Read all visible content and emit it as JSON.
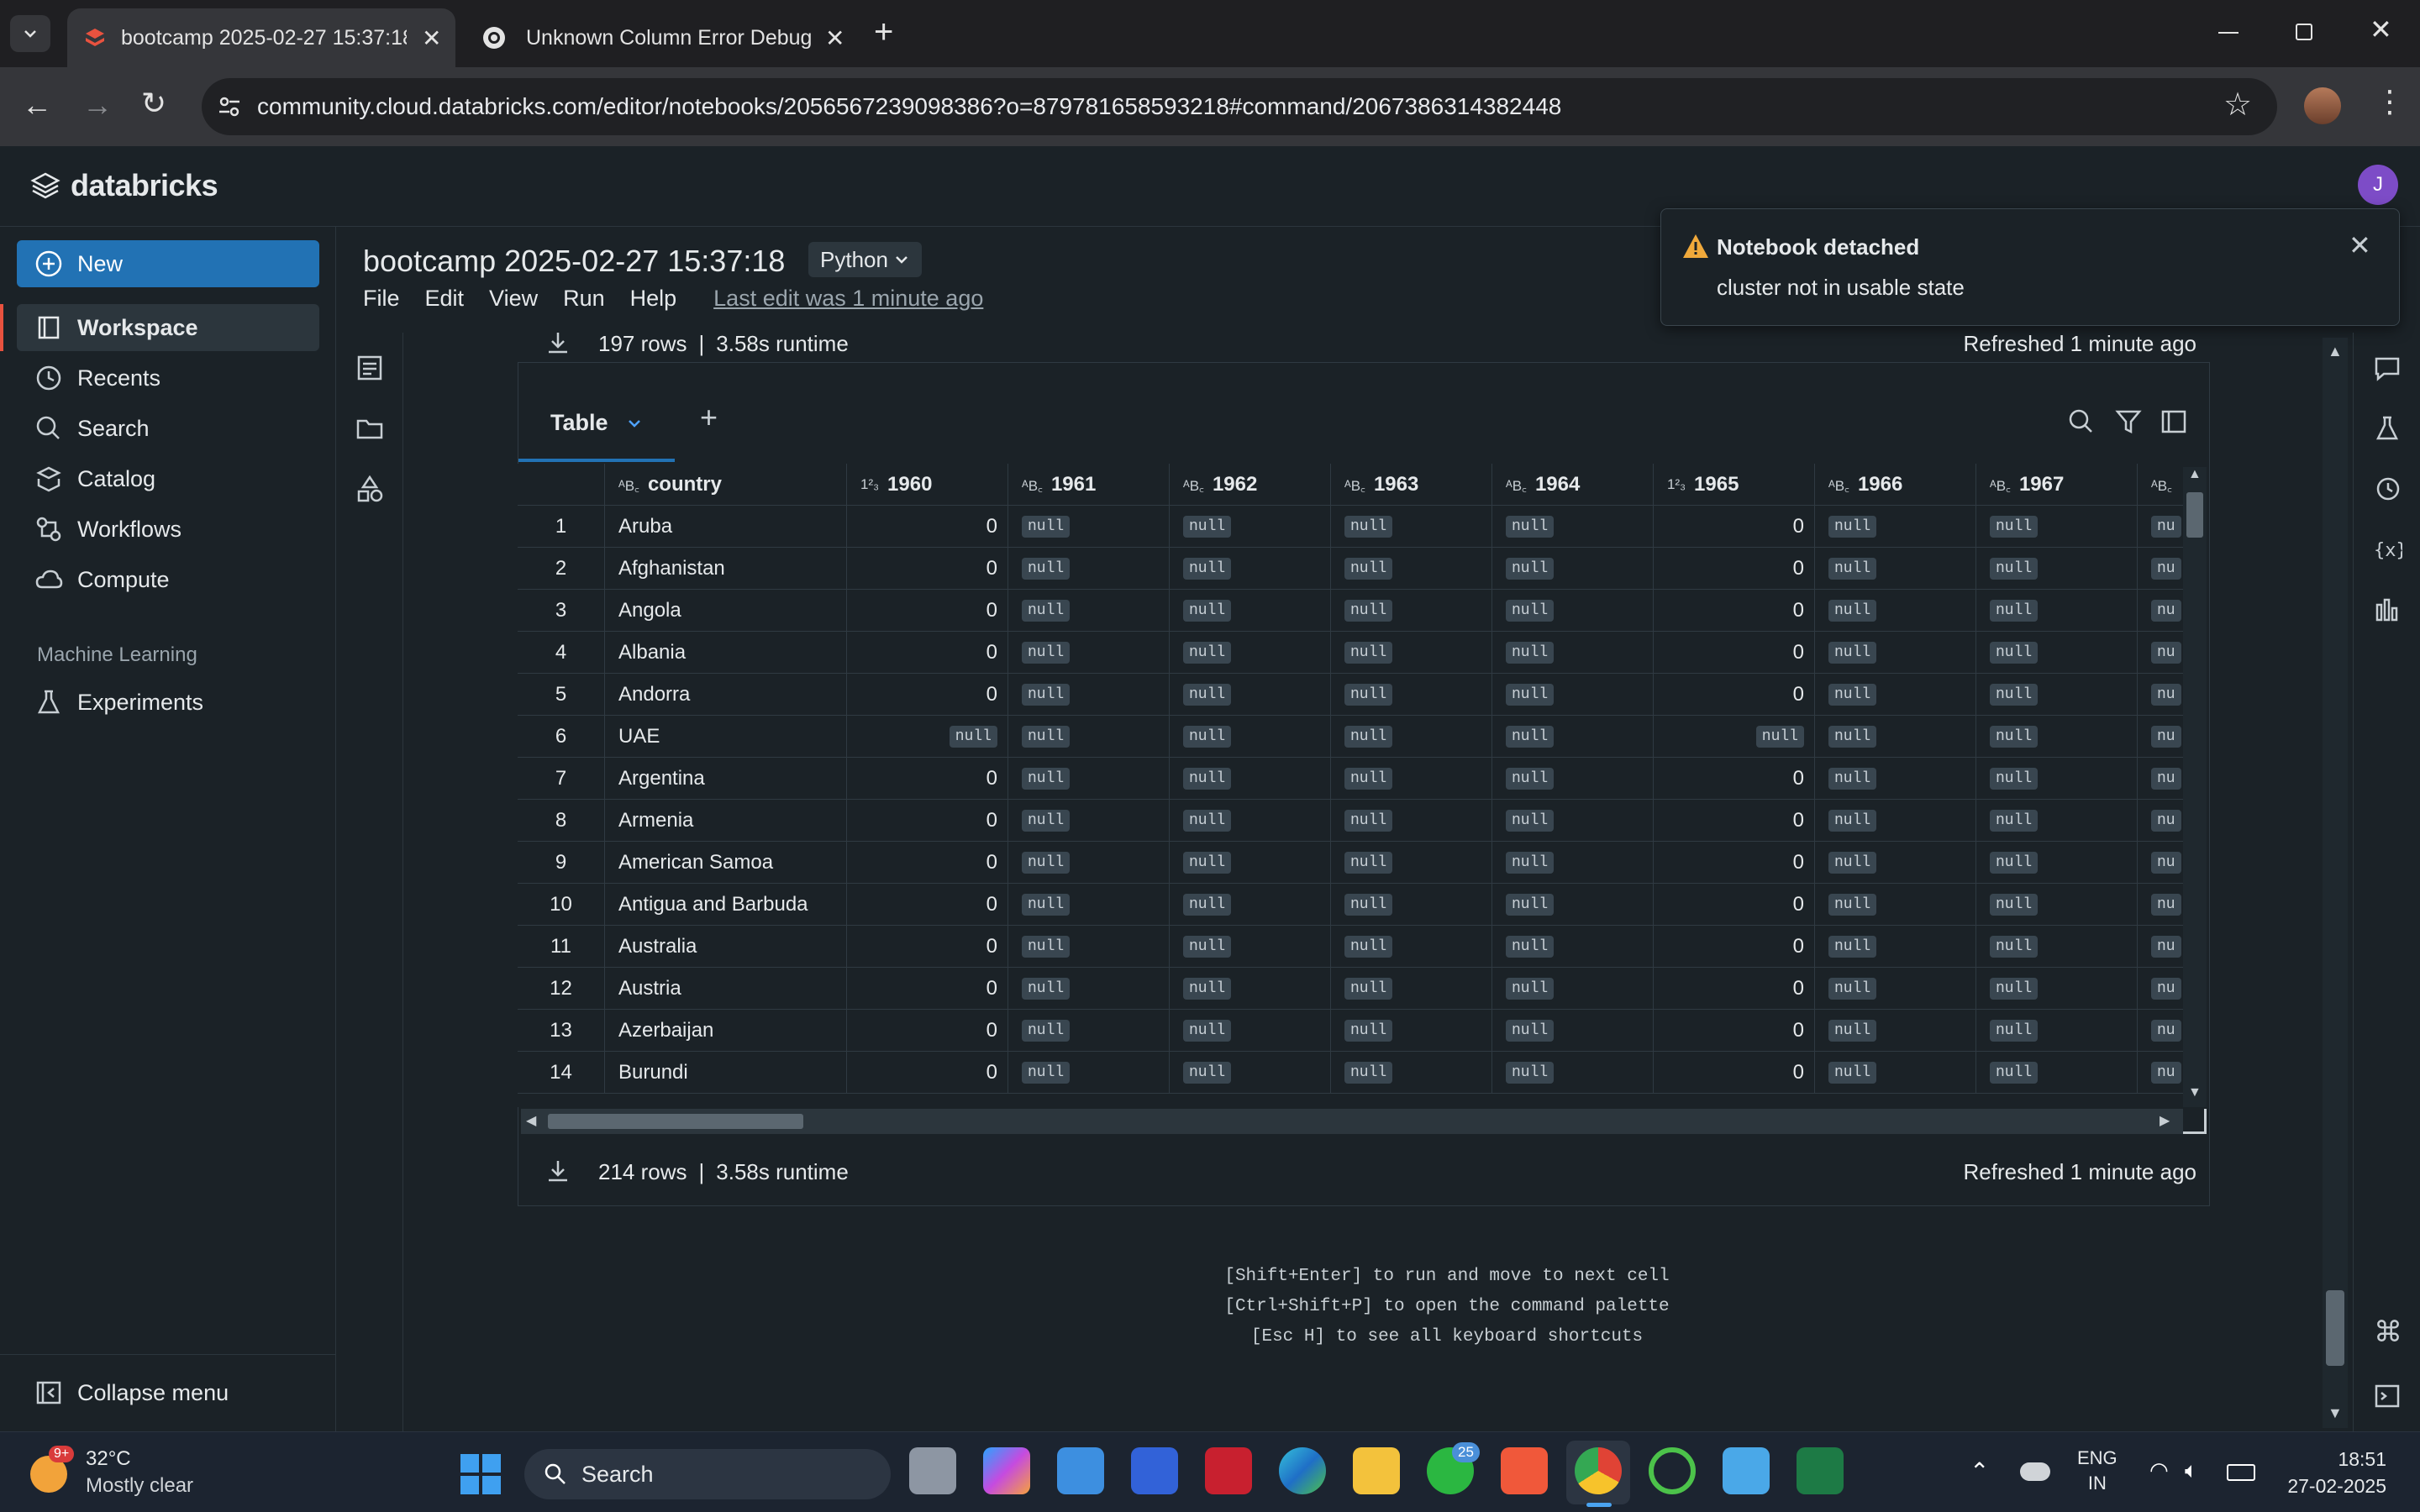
{
  "browser": {
    "tabs": [
      {
        "title": "bootcamp 2025-02-27 15:37:18",
        "active": true
      },
      {
        "title": "Unknown Column Error Debug",
        "active": false
      }
    ],
    "url": "community.cloud.databricks.com/editor/notebooks/2056567239098386?o=879781658593218#command/2067386314382448"
  },
  "app": {
    "logo_text": "databricks",
    "avatar_letter": "J"
  },
  "sidebar": {
    "new_label": "New",
    "items": [
      {
        "label": "Workspace",
        "icon": "workspace-icon",
        "active": true
      },
      {
        "label": "Recents",
        "icon": "clock-icon"
      },
      {
        "label": "Search",
        "icon": "search-icon"
      },
      {
        "label": "Catalog",
        "icon": "catalog-icon"
      },
      {
        "label": "Workflows",
        "icon": "workflows-icon"
      },
      {
        "label": "Compute",
        "icon": "cloud-icon"
      }
    ],
    "section_label": "Machine Learning",
    "ml_items": [
      {
        "label": "Experiments",
        "icon": "flask-icon"
      }
    ],
    "collapse_label": "Collapse menu"
  },
  "notebook": {
    "title": "bootcamp 2025-02-27 15:37:18",
    "language": "Python",
    "menu": [
      "File",
      "Edit",
      "View",
      "Run",
      "Help"
    ],
    "last_edit": "Last edit was 1 minute ago"
  },
  "toast": {
    "title": "Notebook detached",
    "message": "cluster not in usable state"
  },
  "prev_result": {
    "rows": "197 rows",
    "sep": "|",
    "runtime": "3.58s runtime",
    "refreshed": "Refreshed 1 minute ago"
  },
  "result": {
    "tab_label": "Table",
    "rows": "214 rows",
    "sep": "|",
    "runtime": "3.58s runtime",
    "refreshed": "Refreshed 1 minute ago",
    "columns": [
      {
        "name": "country",
        "type": "ABC"
      },
      {
        "name": "1960",
        "type": "123"
      },
      {
        "name": "1961",
        "type": "ABC"
      },
      {
        "name": "1962",
        "type": "ABC"
      },
      {
        "name": "1963",
        "type": "ABC"
      },
      {
        "name": "1964",
        "type": "ABC"
      },
      {
        "name": "1965",
        "type": "123"
      },
      {
        "name": "1966",
        "type": "ABC"
      },
      {
        "name": "1967",
        "type": "ABC"
      },
      {
        "name": "",
        "type": "ABC"
      }
    ],
    "rows_data": [
      {
        "n": "1",
        "cells": [
          "Aruba",
          "0",
          "null",
          "null",
          "null",
          "null",
          "0",
          "null",
          "null",
          "nu"
        ]
      },
      {
        "n": "2",
        "cells": [
          "Afghanistan",
          "0",
          "null",
          "null",
          "null",
          "null",
          "0",
          "null",
          "null",
          "nu"
        ]
      },
      {
        "n": "3",
        "cells": [
          "Angola",
          "0",
          "null",
          "null",
          "null",
          "null",
          "0",
          "null",
          "null",
          "nu"
        ]
      },
      {
        "n": "4",
        "cells": [
          "Albania",
          "0",
          "null",
          "null",
          "null",
          "null",
          "0",
          "null",
          "null",
          "nu"
        ]
      },
      {
        "n": "5",
        "cells": [
          "Andorra",
          "0",
          "null",
          "null",
          "null",
          "null",
          "0",
          "null",
          "null",
          "nu"
        ]
      },
      {
        "n": "6",
        "cells": [
          "UAE",
          "null",
          "null",
          "null",
          "null",
          "null",
          "null",
          "null",
          "null",
          "nu"
        ]
      },
      {
        "n": "7",
        "cells": [
          "Argentina",
          "0",
          "null",
          "null",
          "null",
          "null",
          "0",
          "null",
          "null",
          "nu"
        ]
      },
      {
        "n": "8",
        "cells": [
          "Armenia",
          "0",
          "null",
          "null",
          "null",
          "null",
          "0",
          "null",
          "null",
          "nu"
        ]
      },
      {
        "n": "9",
        "cells": [
          "American Samoa",
          "0",
          "null",
          "null",
          "null",
          "null",
          "0",
          "null",
          "null",
          "nu"
        ]
      },
      {
        "n": "10",
        "cells": [
          "Antigua and Barbuda",
          "0",
          "null",
          "null",
          "null",
          "null",
          "0",
          "null",
          "null",
          "nu"
        ]
      },
      {
        "n": "11",
        "cells": [
          "Australia",
          "0",
          "null",
          "null",
          "null",
          "null",
          "0",
          "null",
          "null",
          "nu"
        ]
      },
      {
        "n": "12",
        "cells": [
          "Austria",
          "0",
          "null",
          "null",
          "null",
          "null",
          "0",
          "null",
          "null",
          "nu"
        ]
      },
      {
        "n": "13",
        "cells": [
          "Azerbaijan",
          "0",
          "null",
          "null",
          "null",
          "null",
          "0",
          "null",
          "null",
          "nu"
        ]
      },
      {
        "n": "14",
        "cells": [
          "Burundi",
          "0",
          "null",
          "null",
          "null",
          "null",
          "0",
          "null",
          "null",
          "nu"
        ]
      }
    ]
  },
  "hints": [
    "[Shift+Enter] to run and move to next cell",
    "[Ctrl+Shift+P] to open the command palette",
    "[Esc H] to see all keyboard shortcuts"
  ],
  "taskbar": {
    "weather_temp": "32°C",
    "weather_desc": "Mostly clear",
    "weather_badge": "9+",
    "search_label": "Search",
    "whatsapp_badge": "25",
    "lang_top": "ENG",
    "lang_bottom": "IN",
    "time": "18:51",
    "date": "27-02-2025"
  },
  "colors": {
    "accent": "#2272b4",
    "background": "#1b2227",
    "toast_warning": "#f0a93b",
    "null_badge": "#394650"
  }
}
